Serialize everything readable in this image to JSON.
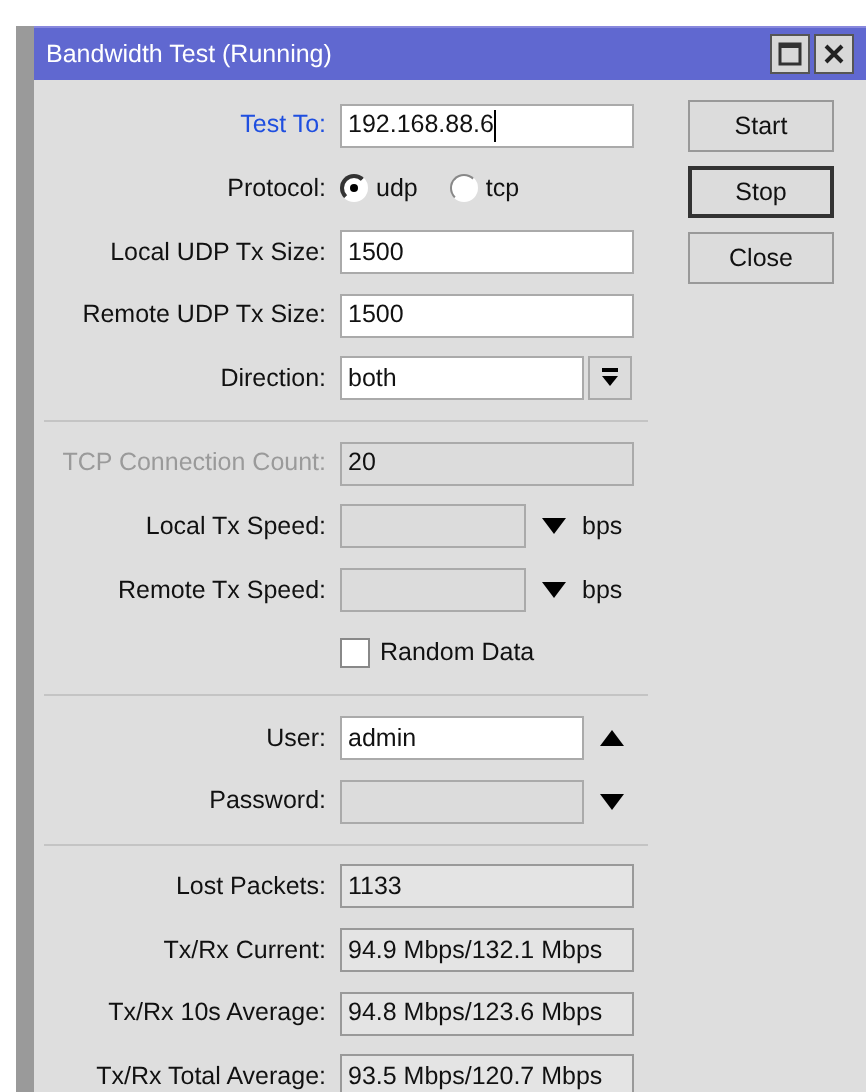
{
  "window": {
    "title": "Bandwidth Test (Running)"
  },
  "rows": [
    {
      "kind": "text",
      "label": "Test To:",
      "value": "192.168.88.6",
      "focused": true,
      "disabled": false
    },
    {
      "kind": "radio",
      "label": "Protocol:",
      "options": [
        {
          "label": "udp",
          "selected": true
        },
        {
          "label": "tcp",
          "selected": false
        }
      ]
    },
    {
      "kind": "text",
      "label": "Local UDP Tx Size:",
      "value": "1500",
      "focused": false,
      "disabled": false
    },
    {
      "kind": "text",
      "label": "Remote UDP Tx Size:",
      "value": "1500",
      "focused": false,
      "disabled": false
    },
    {
      "kind": "select",
      "label": "Direction:",
      "value": "both"
    },
    {
      "kind": "separator"
    },
    {
      "kind": "text",
      "label": "TCP Connection Count:",
      "value": "20",
      "focused": false,
      "disabled": true
    },
    {
      "kind": "speed",
      "label": "Local Tx Speed:",
      "unit": "bps",
      "expanded": false
    },
    {
      "kind": "speed",
      "label": "Remote Tx Speed:",
      "unit": "bps",
      "expanded": false
    },
    {
      "kind": "checkbox",
      "label": "Random Data",
      "checked": false
    },
    {
      "kind": "separator"
    },
    {
      "kind": "combo",
      "label": "User:",
      "value": "admin",
      "expanded": true
    },
    {
      "kind": "combo",
      "label": "Password:",
      "expanded": false
    },
    {
      "kind": "separator"
    },
    {
      "kind": "readout",
      "label": "Lost Packets:",
      "value": "1133"
    },
    {
      "kind": "readout",
      "label": "Tx/Rx Current:",
      "value": "94.9 Mbps/132.1 Mbps"
    },
    {
      "kind": "readout",
      "label": "Tx/Rx 10s Average:",
      "value": "94.8 Mbps/123.6 Mbps"
    },
    {
      "kind": "readout",
      "label": "Tx/Rx Total Average:",
      "value": "93.5 Mbps/120.7 Mbps"
    }
  ],
  "buttons": [
    {
      "label": "Start",
      "default": false
    },
    {
      "label": "Stop",
      "default": true
    },
    {
      "label": "Close",
      "default": false
    }
  ]
}
